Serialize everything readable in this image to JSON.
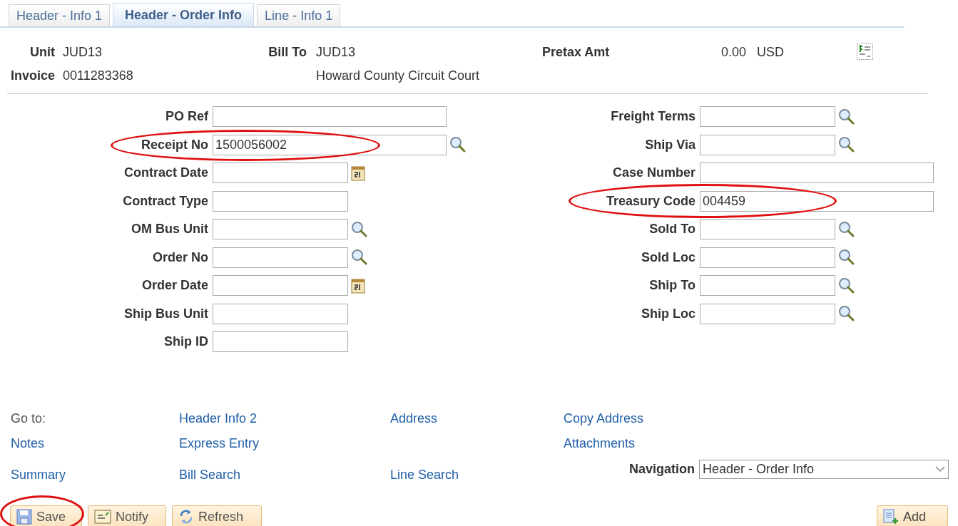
{
  "tabs": [
    {
      "label": "Header - Info 1",
      "selected": false
    },
    {
      "label": "Header - Order Info",
      "selected": true
    },
    {
      "label": "Line - Info 1",
      "selected": false
    }
  ],
  "summary": {
    "unit_label": "Unit",
    "unit": "JUD13",
    "invoice_label": "Invoice",
    "invoice": "0011283368",
    "bill_to_label": "Bill To",
    "bill_to": "JUD13",
    "bill_to_name": "Howard County Circuit Court",
    "pretax_label": "Pretax Amt",
    "pretax_amount": "0.00",
    "currency": "USD"
  },
  "left_fields": [
    {
      "label": "PO Ref",
      "kind": "plain",
      "wide": true,
      "circled": false
    },
    {
      "label": "Receipt No",
      "value": "1500056002",
      "kind": "lookup",
      "wide": true,
      "circled": true
    },
    {
      "label": "Contract Date",
      "kind": "calendar",
      "wide": false,
      "circled": false
    },
    {
      "label": "Contract Type",
      "kind": "plain",
      "wide": false,
      "circled": false
    },
    {
      "label": "OM Bus Unit",
      "kind": "lookup",
      "wide": false,
      "circled": false
    },
    {
      "label": "Order No",
      "kind": "lookup",
      "wide": false,
      "circled": false
    },
    {
      "label": "Order Date",
      "kind": "calendar",
      "wide": false,
      "circled": false
    },
    {
      "label": "Ship Bus Unit",
      "kind": "plain",
      "wide": false,
      "circled": false
    },
    {
      "label": "Ship ID",
      "kind": "plain",
      "wide": false,
      "circled": false
    }
  ],
  "right_fields": [
    {
      "label": "Freight Terms",
      "kind": "lookup",
      "wide": false,
      "circled": false
    },
    {
      "label": "Ship Via",
      "kind": "lookup",
      "wide": false,
      "circled": false
    },
    {
      "label": "Case Number",
      "kind": "plain",
      "wide": true,
      "circled": false
    },
    {
      "label": "Treasury Code",
      "value": "004459",
      "kind": "plain",
      "wide": true,
      "circled": true
    },
    {
      "label": "Sold To",
      "kind": "lookup",
      "wide": false,
      "circled": false
    },
    {
      "label": "Sold Loc",
      "kind": "lookup",
      "wide": false,
      "circled": false
    },
    {
      "label": "Ship To",
      "kind": "lookup",
      "wide": false,
      "circled": false
    },
    {
      "label": "Ship Loc",
      "kind": "lookup",
      "wide": false,
      "circled": false
    }
  ],
  "goto": {
    "label": "Go to:",
    "rows": [
      [
        null,
        "Header Info 2",
        "Address",
        "Copy Address"
      ],
      [
        "Notes",
        "Express Entry",
        null,
        "Attachments"
      ],
      [
        "Summary",
        "Bill Search",
        "Line Search",
        null
      ]
    ]
  },
  "navigation": {
    "label": "Navigation",
    "value": "Header - Order Info"
  },
  "buttons": [
    {
      "label": "Save",
      "kind": "save",
      "circled": true
    },
    {
      "label": "Notify",
      "kind": "notify",
      "circled": false
    },
    {
      "label": "Refresh",
      "kind": "refresh",
      "circled": false
    }
  ],
  "add_button": {
    "label": "Add"
  }
}
